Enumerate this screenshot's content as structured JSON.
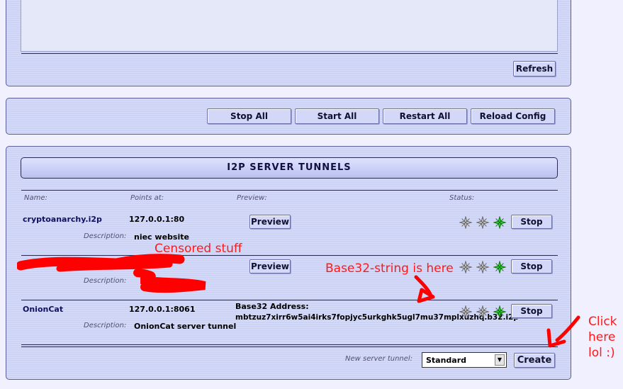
{
  "top_panel": {
    "refresh_label": "Refresh"
  },
  "controls": {
    "stop_all_label": "Stop All",
    "start_all_label": "Start All",
    "restart_all_label": "Restart All",
    "reload_config_label": "Reload Config"
  },
  "tunnels_panel": {
    "title": "I2P SERVER TUNNELS",
    "col_name": "Name:",
    "col_points_at": "Points at:",
    "col_preview": "Preview:",
    "col_status": "Status:",
    "description_label": "Description:",
    "preview_label": "Preview",
    "stop_label": "Stop",
    "tunnels": [
      {
        "name": "cryptoanarchy.i2p",
        "points_at": "127.0.0.1:80",
        "description": "niec website",
        "status": [
          "idle",
          "idle",
          "running"
        ]
      },
      {
        "name": "",
        "points_at": "",
        "description": "",
        "status": [
          "idle",
          "idle",
          "running"
        ]
      },
      {
        "name": "OnionCat",
        "points_at": "127.0.0.1:8061",
        "base32_label": "Base32 Address:",
        "base32_value": "mbtzuz7xirr6w5ai4irks7fopjyc5urkghk5ugl7mu37mplxuzhq.b32.i2p",
        "description": "OnionCat server tunnel",
        "status": [
          "idle",
          "idle",
          "running"
        ]
      }
    ],
    "new_tunnel_label": "New server tunnel:",
    "new_tunnel_selected": "Standard",
    "create_label": "Create"
  },
  "annotations": {
    "censored": "Censored stuff",
    "base32_hint": "Base32-string is here",
    "click_hint_line1": "Click",
    "click_hint_line2": "here",
    "click_hint_line3": "lol :)"
  },
  "colors": {
    "annotation": "#ff1a1a",
    "panel": "#cdd3f5",
    "star_running": "#22cc22",
    "star_idle": "#bbbbbb"
  }
}
